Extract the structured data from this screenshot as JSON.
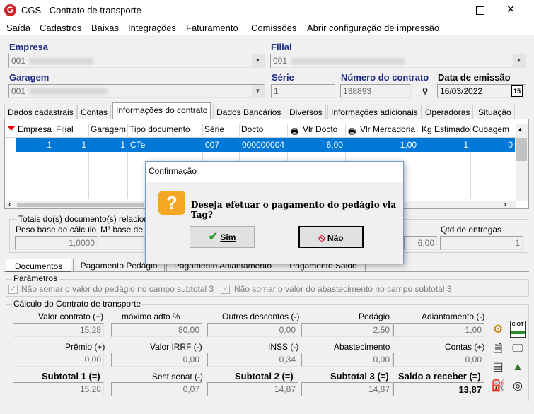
{
  "window": {
    "title": "CGS - Contrato de transporte",
    "app_icon": "G"
  },
  "menu": [
    "Saída",
    "Cadastros",
    "Baixas",
    "Integrações",
    "Faturamento",
    "Comissões",
    "Abrir configuração de impressão"
  ],
  "header": {
    "empresa_label": "Empresa",
    "empresa_value": "001",
    "filial_label": "Filial",
    "filial_value": "001",
    "garagem_label": "Garagem",
    "garagem_value": "001",
    "serie_label": "Série",
    "serie_value": "1",
    "numero_label": "Número do contrato",
    "numero_value": "138893",
    "data_label": "Data de emissão",
    "data_value": "16/03/2022",
    "calendar_icon": "15"
  },
  "tabs": [
    "Dados cadastrais",
    "Contas",
    "Informações do contrato",
    "Dados Bancários",
    "Diversos",
    "Informações adicionais",
    "Operadoras",
    "Situação"
  ],
  "active_tab": "Informações do contrato",
  "grid": {
    "columns": [
      "Empresa",
      "Filial",
      "Garagem",
      "Tipo documento",
      "Série",
      "Docto",
      "Vlr Docto",
      "Vlr Mercadoria",
      "Kg Estimado",
      "Cubagem"
    ],
    "rows": [
      [
        "1",
        "1",
        "1",
        "CTe",
        "007",
        "000000004",
        "6,00",
        "1,00",
        "1",
        "0"
      ]
    ]
  },
  "totais": {
    "group_title": "Totais do(s) documento(s) relacion",
    "peso_label": "Peso base de cálculo",
    "peso_value": "1,0000",
    "m3_label": "M³ base de",
    "vlr_value": "6,00",
    "qtd_label": "Qtd de entregas",
    "qtd_value": "1"
  },
  "subtabs": [
    "Documentos",
    "Pagamento Pedágio",
    "Pagamento Adiantamento",
    "Pagamento Saldo"
  ],
  "parametros": {
    "title": "Parâmetros",
    "opt1": "Não somar o valor do pedágio no campo subtotal 3",
    "opt2": "Não somar o valor do abastecimento no campo subtotal 3"
  },
  "calculo": {
    "title": "Cálculo do Contrato de transporte",
    "valor_contrato_label": "Valor contrato (+)",
    "valor_contrato": "15,28",
    "maximo_adto_label": "máximo adto %",
    "maximo_adto": "80,00",
    "outros_label": "Outros descontos (-)",
    "outros": "0,00",
    "pedagio_label": "Pedágio",
    "pedagio": "2,50",
    "adiantamento_label": "Adiantamento (-)",
    "adiantamento": "1,00",
    "premio_label": "Prêmio (+)",
    "premio": "0,00",
    "irrf_label": "Valor IRRF (-)",
    "irrf": "0,00",
    "inss_label": "INSS (-)",
    "inss": "0,34",
    "abastecimento_label": "Abastecimento",
    "abastecimento": "0,00",
    "contas_label": "Contas (+)",
    "contas": "0,00",
    "subtotal1_label": "Subtotal 1 (=)",
    "subtotal1": "15,28",
    "sest_label": "Sest senat (-)",
    "sest": "0,07",
    "subtotal2_label": "Subtotal 2 (=)",
    "subtotal2": "14,87",
    "subtotal3_label": "Subtotal 3 (=)",
    "subtotal3": "14,87",
    "saldo_label": "Saldo a receber (=)",
    "saldo": "13,87"
  },
  "side_icons": {
    "ciot_label": "CIOT"
  },
  "dialog": {
    "title": "Confirmação",
    "message": "Deseja efetuar o pagamento do pedágio via Tag?",
    "yes_label": "Sim",
    "no_label": "Não"
  },
  "colors": {
    "label_blue": "#1e2c84",
    "selection": "#0078d7",
    "warning": "#f5a623",
    "brand": "#d4202a"
  }
}
